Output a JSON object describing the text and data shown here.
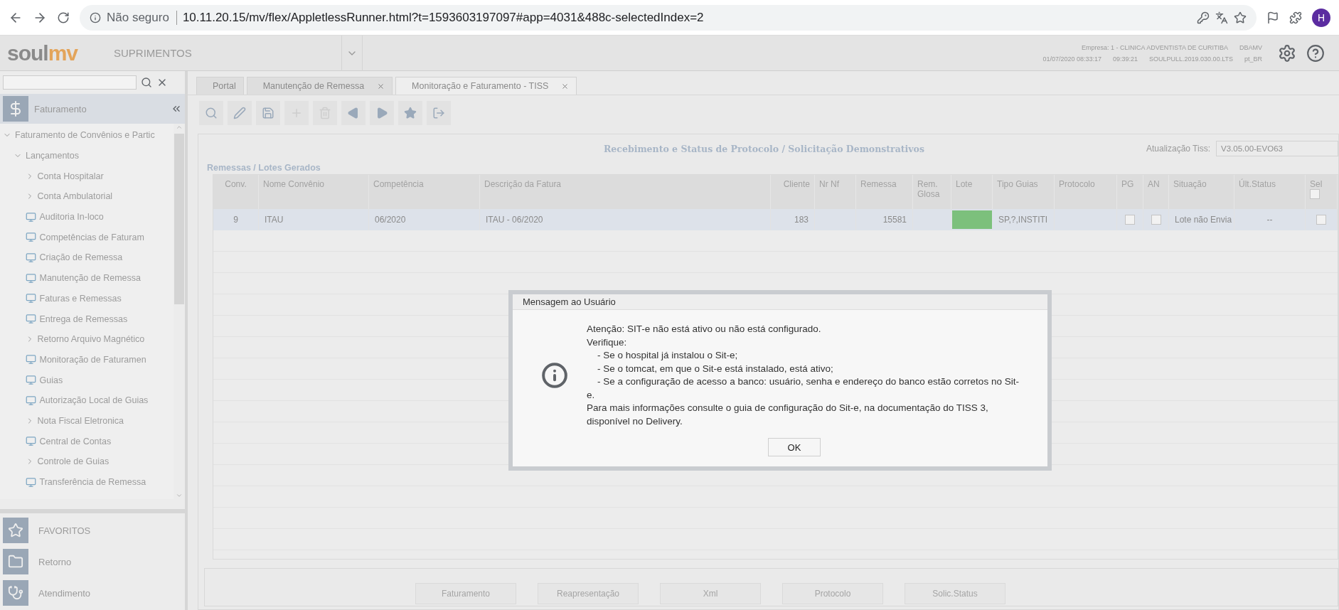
{
  "browser": {
    "security": "Não seguro",
    "url": "10.11.20.15/mv/flex/AppletlessRunner.html?t=1593603197097#app=4031&488c-selectedIndex=2",
    "avatar": "H"
  },
  "header": {
    "logo_a": "soul",
    "logo_b": "mv",
    "module": "SUPRIMENTOS",
    "company": "Empresa: 1 - CLINICA ADVENTISTA DE CURITIBA",
    "db": "DBAMV",
    "date": "01/07/2020 08:33:17",
    "time": "09:39:21",
    "version": "SOULPULL.2019.030.00.LTS",
    "locale": "pt_BR"
  },
  "sidebar": {
    "section": "Faturamento",
    "tree": [
      {
        "label": "Faturamento de Convênios e Partic",
        "kind": "folder",
        "expanded": true,
        "children": [
          {
            "label": "Lançamentos",
            "kind": "folder",
            "expanded": true,
            "children": [
              {
                "label": "Conta Hospitalar",
                "kind": "folder",
                "expanded": false
              },
              {
                "label": "Conta Ambulatorial",
                "kind": "folder",
                "expanded": false
              },
              {
                "label": "Auditoria In-loco",
                "kind": "screen"
              },
              {
                "label": "Competências de Faturam",
                "kind": "screen"
              },
              {
                "label": "Criação de Remessa",
                "kind": "screen"
              },
              {
                "label": "Manutenção de Remessa",
                "kind": "screen"
              },
              {
                "label": "Faturas e Remessas",
                "kind": "screen"
              },
              {
                "label": "Entrega de Remessas",
                "kind": "screen"
              },
              {
                "label": "Retorno Arquivo Magnético",
                "kind": "folder",
                "expanded": false
              },
              {
                "label": "Monitoração de Faturamen",
                "kind": "screen"
              },
              {
                "label": "Guias",
                "kind": "screen"
              },
              {
                "label": "Autorização Local de Guias",
                "kind": "screen"
              },
              {
                "label": "Nota Fiscal Eletronica",
                "kind": "folder",
                "expanded": false
              },
              {
                "label": "Central de Contas",
                "kind": "screen"
              },
              {
                "label": "Controle de Guias",
                "kind": "folder",
                "expanded": false
              },
              {
                "label": "Transferência de Remessa",
                "kind": "screen"
              }
            ]
          }
        ]
      }
    ],
    "shortcuts": [
      {
        "label": "FAVORITOS",
        "kind": "star"
      },
      {
        "label": "Retorno",
        "kind": "folder"
      },
      {
        "label": "Atendimento",
        "kind": "stethoscope"
      }
    ]
  },
  "tabs": [
    {
      "label": "Portal",
      "selected": false,
      "closable": false
    },
    {
      "label": "Manutenção de Remessa",
      "selected": false,
      "closable": true
    },
    {
      "label": "Monitoração e Faturamento - TISS",
      "selected": true,
      "closable": true
    }
  ],
  "toolbar": [
    {
      "kind": "search",
      "disabled": false
    },
    {
      "kind": "edit",
      "disabled": false
    },
    {
      "kind": "save",
      "disabled": false
    },
    {
      "kind": "add",
      "disabled": true
    },
    {
      "kind": "delete",
      "disabled": true
    },
    {
      "kind": "prev",
      "disabled": false
    },
    {
      "kind": "next",
      "disabled": false
    },
    {
      "kind": "star",
      "disabled": false
    },
    {
      "kind": "export",
      "disabled": false
    }
  ],
  "form": {
    "title": "Recebimento e Status de Protocolo / Solicitação Demonstrativos",
    "tiss_label": "Atualização Tiss:",
    "tiss_value": "V3.05.00-EVO63",
    "group": "Remessas / Lotes Gerados"
  },
  "table": {
    "columns": [
      "Conv.",
      "Nome Convênio",
      "Competência",
      "Descrição da Fatura",
      "Cliente",
      "Nr Nf",
      "Remessa",
      "Rem. Glosa",
      "Lote",
      "Tipo Guias",
      "Protocolo",
      "PG",
      "AN",
      "Situação",
      "Últ.Status",
      "Sel"
    ],
    "sel_all_checked": false,
    "rows": [
      {
        "selected": true,
        "conv": "9",
        "nome": "ITAU",
        "competencia": "06/2020",
        "descricao": "ITAU - 06/2020",
        "cliente": "183",
        "remessa": "15581",
        "tipo": "SP,?,INSTITI",
        "pg": false,
        "an": false,
        "situacao": "Lote não Envia",
        "ult_status": "--",
        "sel": false
      }
    ]
  },
  "buttons": [
    "Faturamento",
    "Reapresentação",
    "Xml",
    "Protocolo",
    "Solic.Status"
  ],
  "dialog": {
    "title": "Mensagem ao Usuário",
    "lines": [
      "Atenção: SIT-e não está ativo ou não está configurado.",
      "Verifique:",
      "    - Se o hospital já instalou o Sit-e;",
      "    - Se o tomcat, em que o Sit-e está instalado, está ativo;",
      "    - Se a configuração de acesso a banco: usuário, senha e endereço do banco estão corretos no Sit-e.",
      "Para mais informações consulte o guia de configuração do Sit-e, na documentação do TISS 3, disponível no Delivery."
    ],
    "ok": "OK"
  }
}
